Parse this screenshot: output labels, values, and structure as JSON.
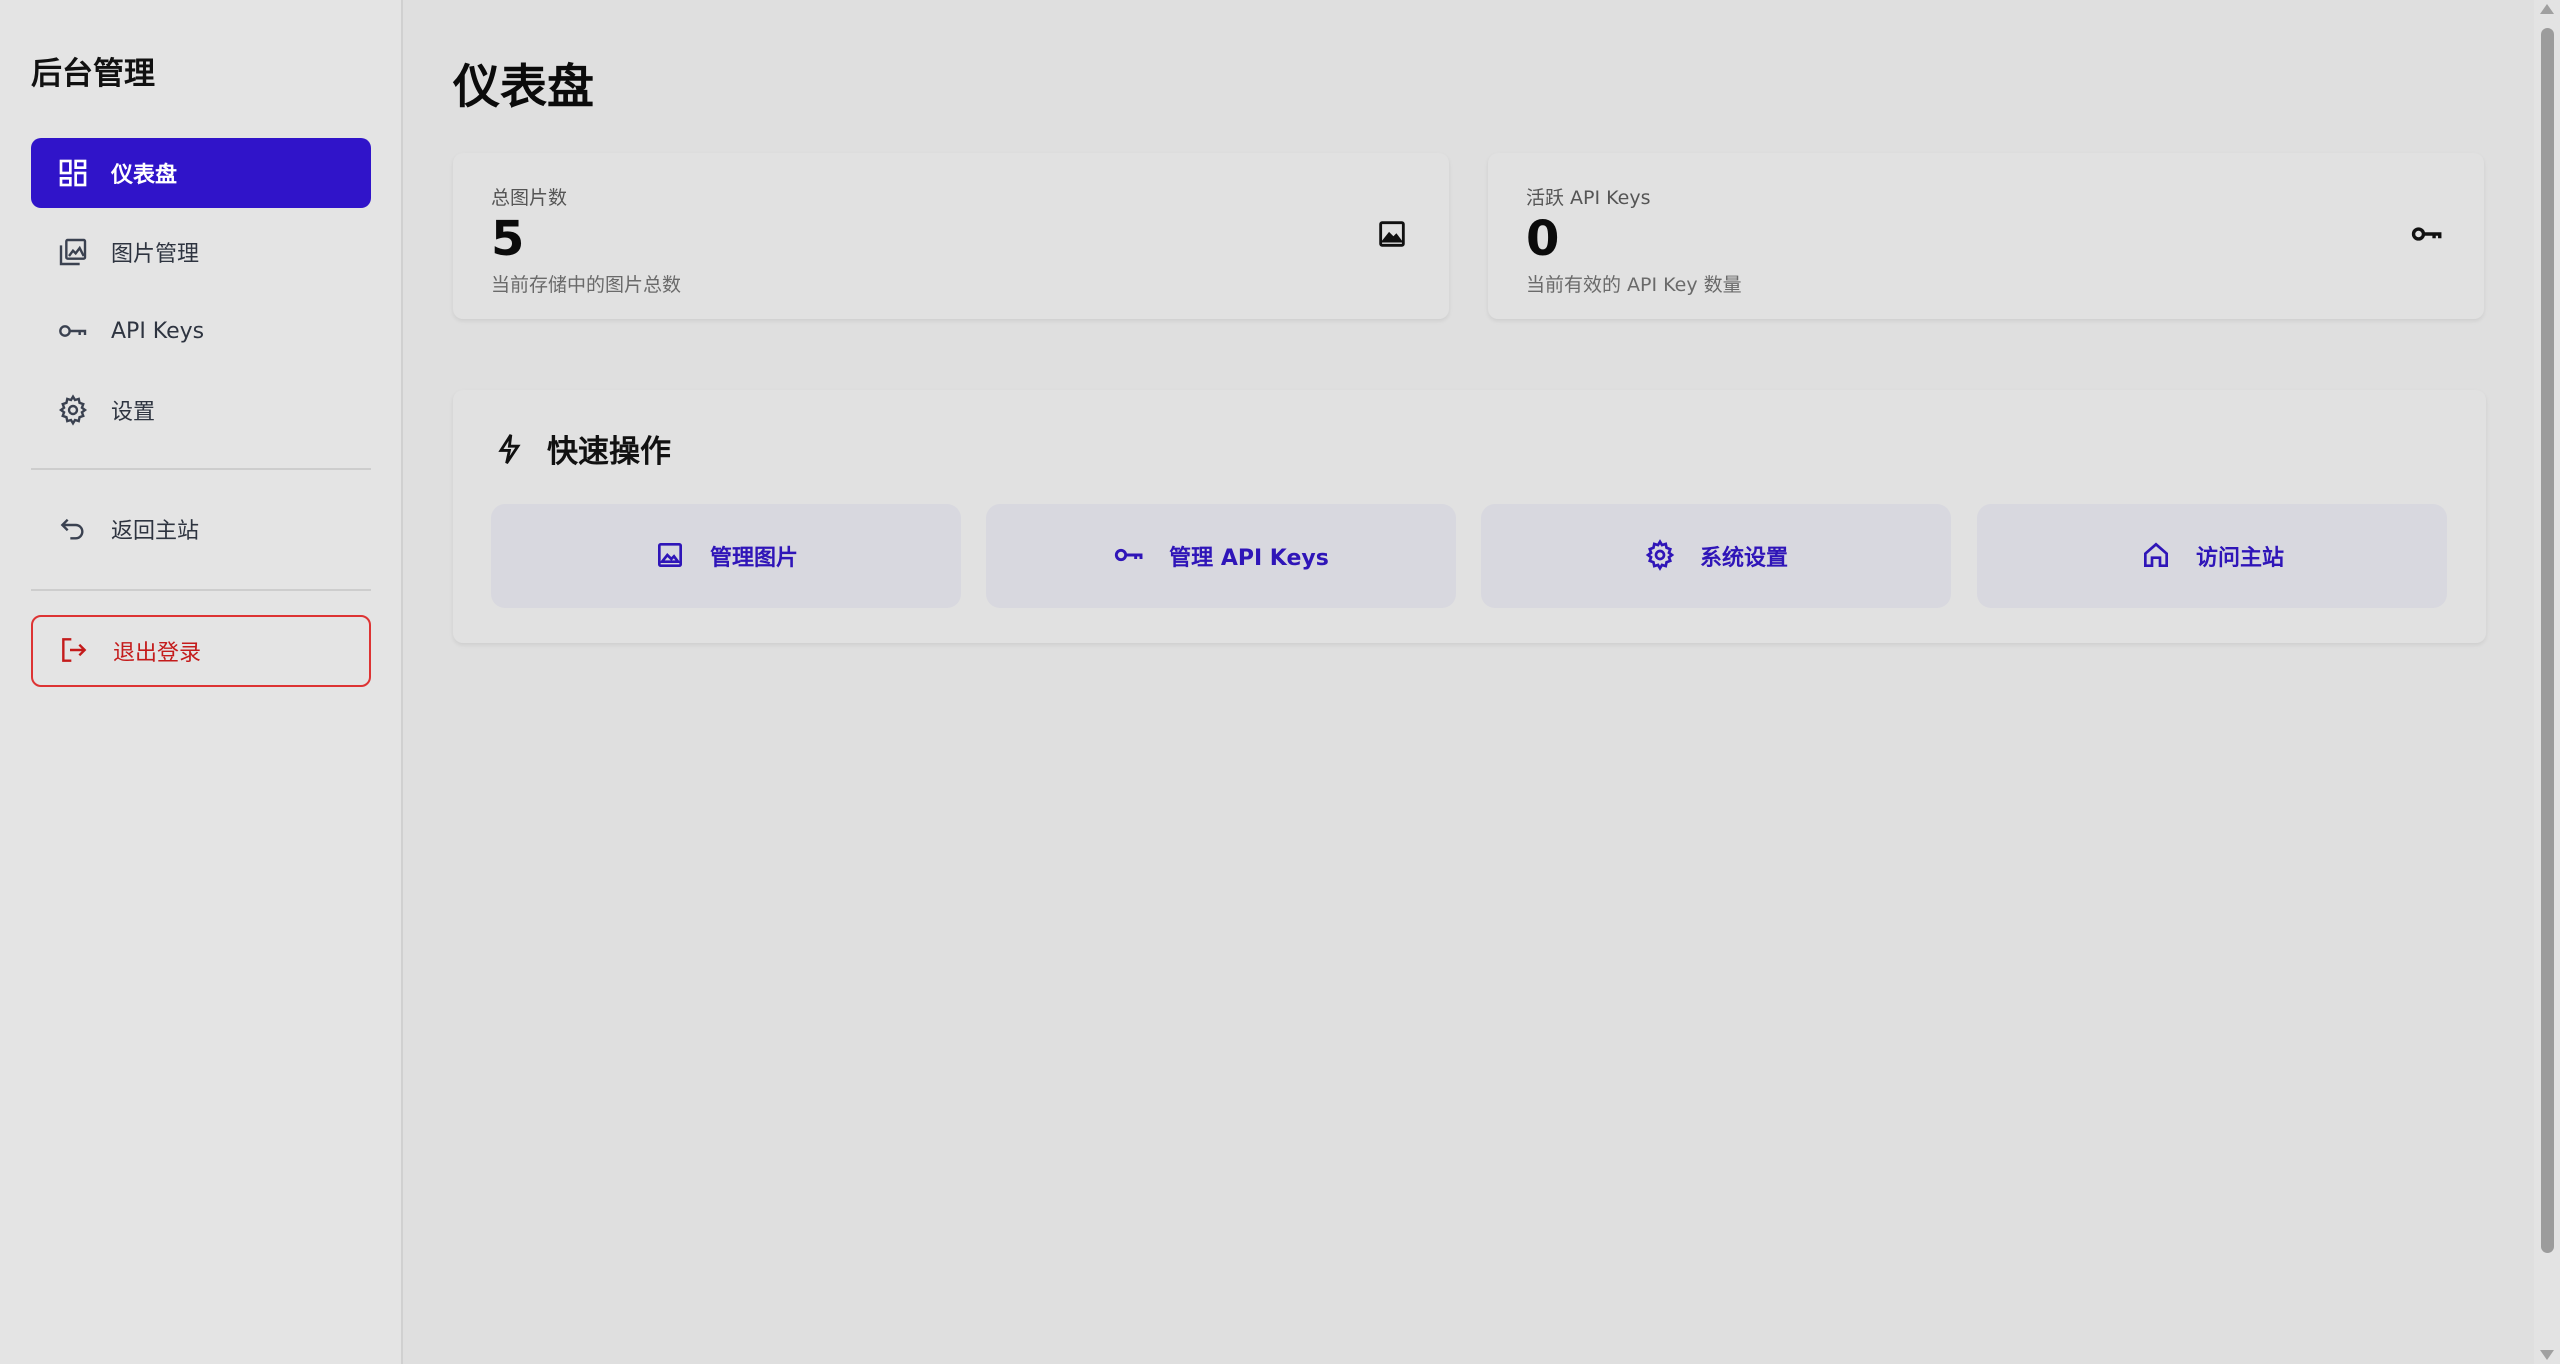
{
  "sidebar": {
    "brand": "后台管理",
    "items": [
      {
        "label": "仪表盘",
        "icon": "dashboard-icon",
        "active": true
      },
      {
        "label": "图片管理",
        "icon": "images-icon",
        "active": false
      },
      {
        "label": "API Keys",
        "icon": "key-icon",
        "active": false
      },
      {
        "label": "设置",
        "icon": "gear-icon",
        "active": false
      }
    ],
    "back_label": "返回主站",
    "logout_label": "退出登录"
  },
  "main": {
    "title": "仪表盘",
    "stats": [
      {
        "label": "总图片数",
        "value": "5",
        "desc": "当前存储中的图片总数",
        "icon": "image-icon"
      },
      {
        "label": "活跃 API Keys",
        "value": "0",
        "desc": "当前有效的 API Key 数量",
        "icon": "key-icon"
      }
    ],
    "quick": {
      "title": "快速操作",
      "icon": "lightning-icon",
      "actions": [
        {
          "label": "管理图片",
          "icon": "image-icon"
        },
        {
          "label": "管理 API Keys",
          "icon": "key-icon"
        },
        {
          "label": "系统设置",
          "icon": "gear-icon"
        },
        {
          "label": "访问主站",
          "icon": "home-icon"
        }
      ]
    }
  },
  "colors": {
    "accent": "#3014c9",
    "danger": "#c41b1b",
    "background": "#dfdfdf"
  }
}
